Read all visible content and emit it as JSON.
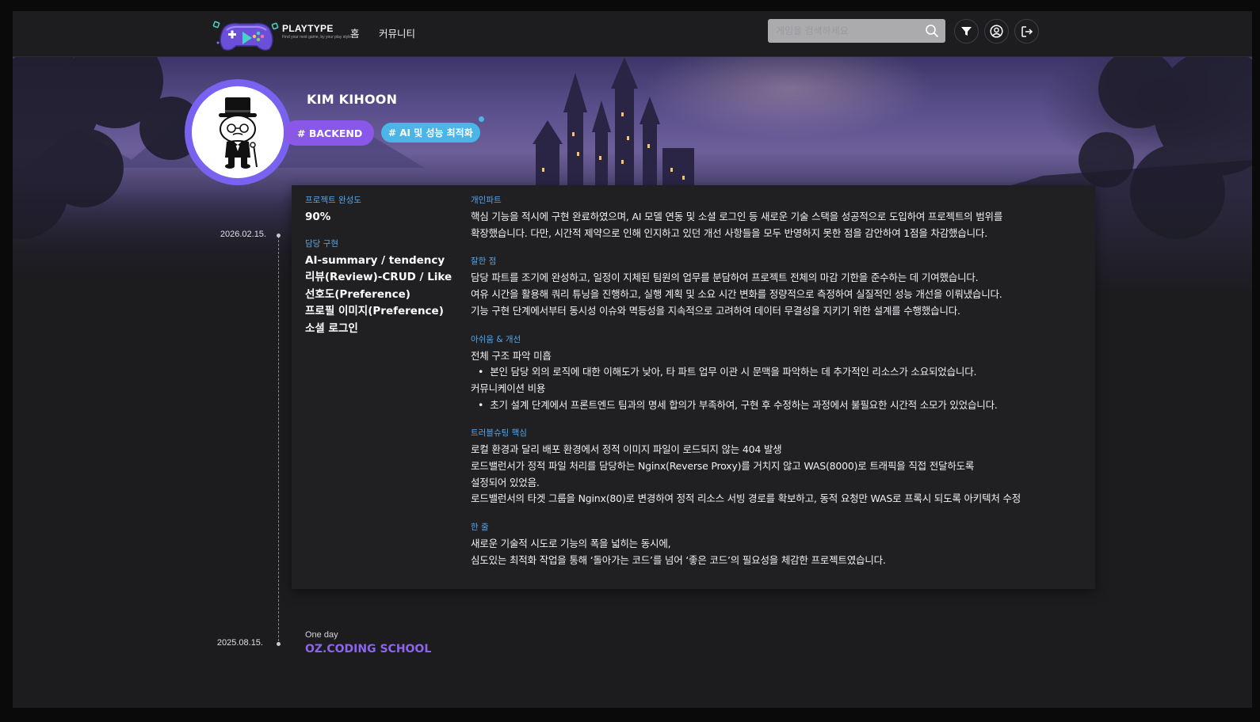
{
  "header": {
    "brand_name": "PLAYTYPE",
    "brand_tagline": "Find your next game, by your play style",
    "nav": {
      "home": "홈",
      "community": "커뮤니티"
    },
    "search_placeholder": "게임을 검색하세요"
  },
  "profile": {
    "name": "KIM KIHOON",
    "tags": [
      "# BACKEND",
      "# AI 및 성능 최적화"
    ]
  },
  "timeline": [
    {
      "date": "2026.02.15.",
      "completion_label": "프로젝트 완성도",
      "completion_value": "90%",
      "impl_label": "담당 구현",
      "impl_items": [
        "AI-summary / tendency",
        "리뷰(Review)-CRUD / Like",
        "선호도(Preference)",
        "프로필 이미지(Preference)",
        "소셜 로그인"
      ],
      "sections": {
        "personal": {
          "label": "개인파트",
          "lines": [
            "핵심 기능을 적시에 구현 완료하였으며, AI 모델 연동 및 소셜 로그인 등 새로운 기술 스택을 성공적으로 도입하여 프로젝트의 범위를",
            "확장했습니다. 다만, 시간적 제약으로 인해 인지하고 있던 개선 사항들을 모두 반영하지 못한 점을 감안하여 1점을 차감했습니다."
          ]
        },
        "good": {
          "label": "잘한 점",
          "lines": [
            "담당 파트를 조기에 완성하고, 일정이 지체된 팀원의 업무를 분담하여 프로젝트 전체의 마감 기한을 준수하는 데 기여했습니다.",
            "여유 시간을 활용해 쿼리 튜닝을 진행하고, 실행 계획 및 소요 시간 변화를 정량적으로 측정하여 실질적인 성능 개선을 이뤄냈습니다.",
            "기능 구현 단계에서부터 동시성 이슈와 멱등성을 지속적으로 고려하여 데이터 무결성을 지키기 위한 설계를 수행했습니다."
          ]
        },
        "improve": {
          "label": "아쉬움 & 개선",
          "item1_title": "전체 구조 파악 미흡",
          "item1_bullet": "본인 담당 외의 로직에 대한 이해도가 낮아, 타 파트 업무 이관 시 문맥을 파악하는 데 추가적인 리소스가 소요되었습니다.",
          "item2_title": "커뮤니케이션 비용",
          "item2_bullet": "초기 설계 단계에서 프론트엔드 팀과의 명세 합의가 부족하여, 구현 후 수정하는 과정에서 불필요한 시간적 소모가 있었습니다."
        },
        "trouble": {
          "label": "트러블슈팅 핵심",
          "lines": [
            "로컬 환경과 달리 배포 환경에서 정적 이미지 파일이 로드되지 않는 404 발생",
            "로드밸런서가 정적 파일 처리를 담당하는 Nginx(Reverse Proxy)를 거치지 않고 WAS(8000)로 트래픽을 직접 전달하도록",
            "설정되어 있었음.",
            "로드밸런서의 타겟 그룹을 Nginx(80)로 변경하여 정적 리소스 서빙 경로를 확보하고, 동적 요청만 WAS로 프록시 되도록 아키텍처 수정"
          ]
        },
        "oneline": {
          "label": "한 줄",
          "lines": [
            "새로운 기술적 시도로 기능의 폭을 넓히는 동시에,",
            "심도있는 최적화 작업을 통해 ‘돌아가는 코드’를 넘어 ‘좋은 코드’의 필요성을 체감한 프로젝트였습니다."
          ]
        }
      }
    },
    {
      "date": "2025.08.15.",
      "subtitle": "One day",
      "title": "OZ.CODING SCHOOL"
    }
  ],
  "colors": {
    "accent_purple": "#8a58e8",
    "accent_blue": "#4ab5e6",
    "label_blue": "#58a6e8",
    "avatar_ring": "#7a62f0"
  },
  "icons": [
    "logo-icon",
    "search-icon",
    "filter-icon",
    "user-circle-icon",
    "logout-icon"
  ]
}
